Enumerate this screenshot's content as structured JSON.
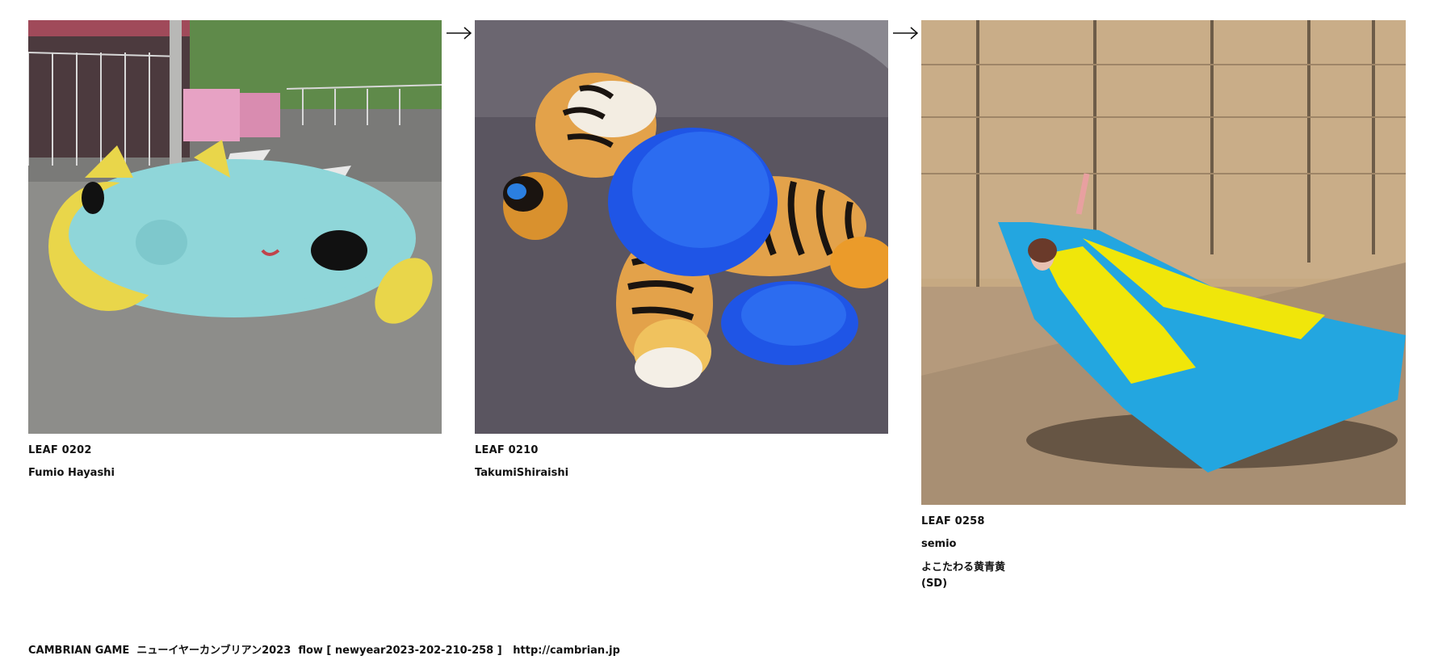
{
  "leaves": [
    {
      "code": "LEAF 0202",
      "author": "Fumio Hayashi",
      "title": "",
      "image_alt": "knitted-blue-creature-on-street"
    },
    {
      "code": "LEAF 0210",
      "author": "TakumiShiraishi",
      "title": "",
      "image_alt": "tiger-plush-with-blue-fur"
    },
    {
      "code": "LEAF 0258",
      "author": "semio",
      "title": "よこたわる黄青黄\n(SD)",
      "image_alt": "person-in-blue-yellow-fabric"
    }
  ],
  "arrows": [
    "arrow-right-icon",
    "arrow-right-icon"
  ],
  "footer": {
    "brand": "CAMBRIAN GAME",
    "event": "ニューイヤーカンブリアン2023",
    "flow": "flow [ newyear2023-202-210-258 ]",
    "url": "http://cambrian.jp"
  }
}
